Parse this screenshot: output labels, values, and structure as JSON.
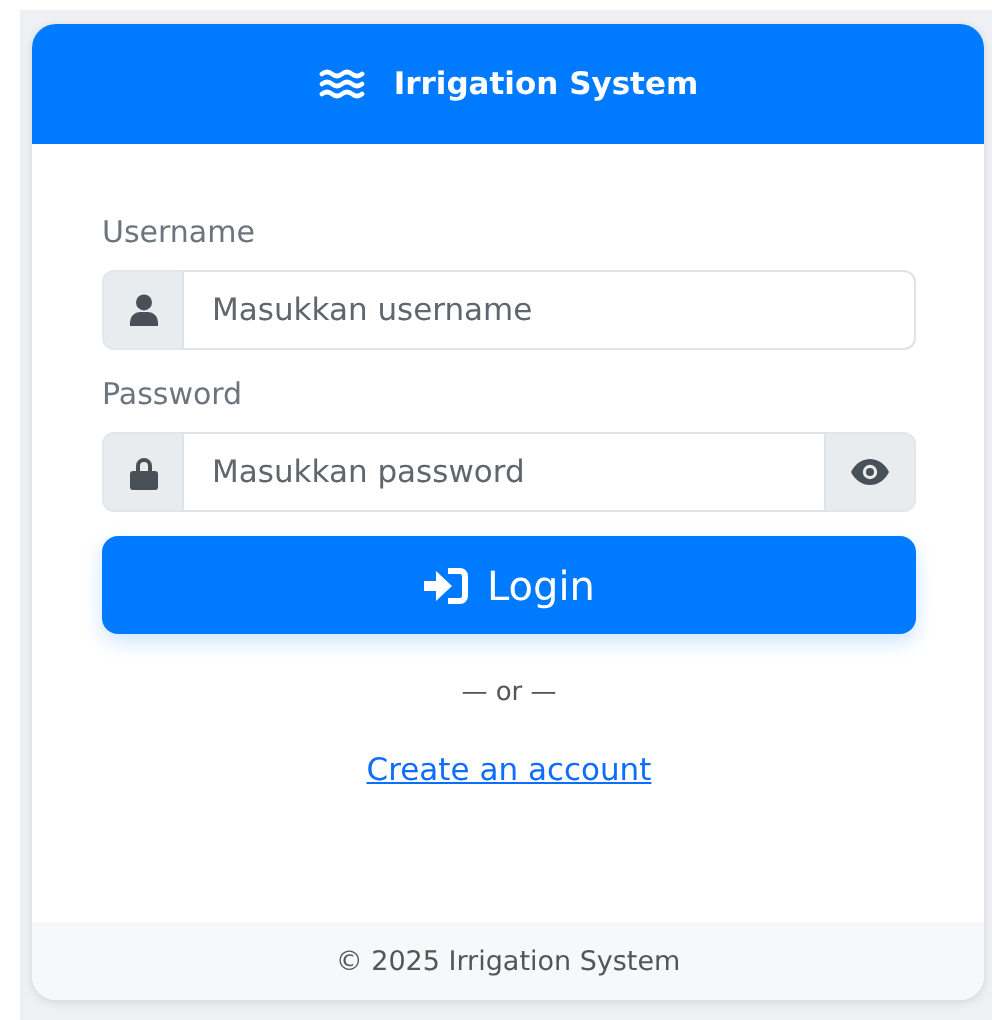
{
  "header": {
    "title": "Irrigation System"
  },
  "fields": [
    {
      "kind": "username",
      "label": "Username",
      "placeholder": "Masukkan username"
    },
    {
      "kind": "password",
      "label": "Password",
      "placeholder": "Masukkan password"
    }
  ],
  "login_button": {
    "label": "Login"
  },
  "divider": "— or —",
  "register_link": "Create an account",
  "footer": "© 2025 Irrigation System"
}
